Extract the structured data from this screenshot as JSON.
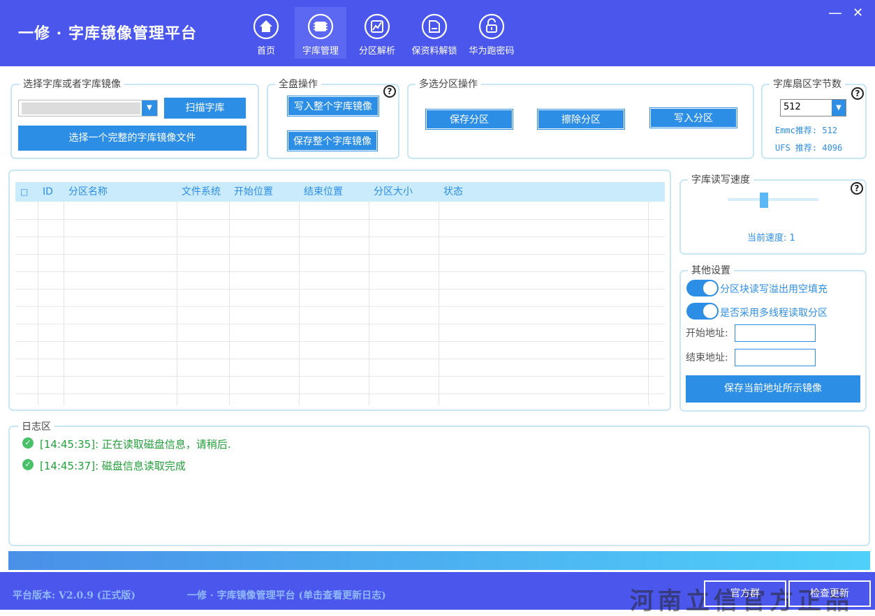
{
  "app": {
    "title": "一修 · 字库镜像管理平台"
  },
  "nav": [
    {
      "label": "首页",
      "icon": "home-icon"
    },
    {
      "label": "字库管理",
      "icon": "chip-icon"
    },
    {
      "label": "分区解析",
      "icon": "chart-icon"
    },
    {
      "label": "保资料解锁",
      "icon": "folder-icon"
    },
    {
      "label": "华为跑密码",
      "icon": "unlock-icon"
    }
  ],
  "window": {
    "minimize": "—",
    "close": "✕"
  },
  "select_group": {
    "label": "选择字库或者字库镜像",
    "device_value": "",
    "scan_button": "扫描字库",
    "select_file_button": "选择一个完整的字库镜像文件"
  },
  "full_disk": {
    "label": "全盘操作",
    "help": "?",
    "write_button": "写入整个字库镜像",
    "save_button": "保存整个字库镜像"
  },
  "multi_partition": {
    "label": "多选分区操作",
    "save_button": "保存分区",
    "erase_button": "擦除分区",
    "write_button": "写入分区"
  },
  "sector": {
    "label": "字库扇区字节数",
    "help": "?",
    "value": "512",
    "emmc_hint": "Emmc推荐: 512",
    "ufs_hint": "UFS 推荐: 4096"
  },
  "table": {
    "columns": [
      "□",
      "ID",
      "分区名称",
      "文件系统",
      "开始位置",
      "结束位置",
      "分区大小",
      "状态"
    ],
    "rows": []
  },
  "speed": {
    "label": "字库读写速度",
    "help": "?",
    "level": 1,
    "current_text": "当前速度: 1"
  },
  "other": {
    "label": "其他设置",
    "fill_toggle_label": "分区块读写溢出用空填充",
    "thread_toggle_label": "是否采用多线程读取分区",
    "start_label": "开始地址:",
    "end_label": "结束地址:",
    "start_value": "",
    "end_value": "",
    "save_button": "保存当前地址所示镜像"
  },
  "log": {
    "label": "日志区",
    "entries": [
      "[14:45:35]: 正在读取磁盘信息，请稍后.",
      "[14:45:37]: 磁盘信息读取完成"
    ]
  },
  "footer": {
    "version": "平台版本: V2.0.9 (正式版)",
    "link": "一修 · 字库镜像管理平台 (单击查看更新日志)",
    "group_button": "官方群",
    "update_button": "检查更新",
    "watermark": "河南立信官方正品"
  },
  "colors": {
    "header": "#4a56ec",
    "accent": "#2d8ee6",
    "table_header": "#c9ebfb",
    "log_text": "#22a03a"
  }
}
